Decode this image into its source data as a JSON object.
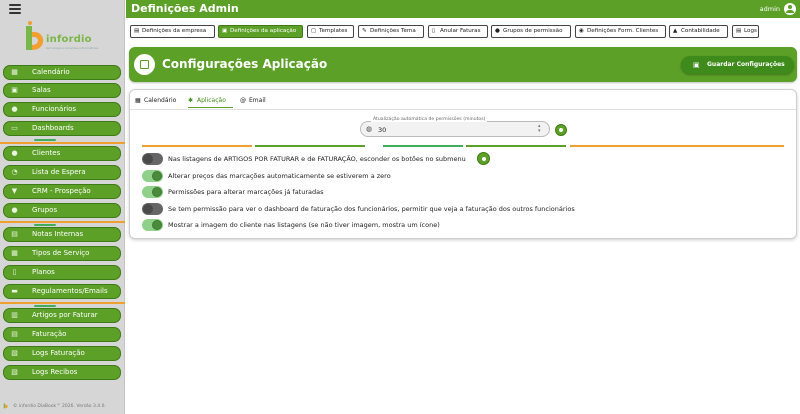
{
  "app": {
    "title": "Definições Admin",
    "user": "admin",
    "logo_text": "infordio",
    "logo_sub": "tecnologia e soluções informáticas",
    "footer": "© infordio DiaBook™ 2026. Versão 3.4.0."
  },
  "sidebar": {
    "items": [
      {
        "label": "Calendário",
        "icon": "calendar-icon"
      },
      {
        "label": "Salas",
        "icon": "door-icon"
      },
      {
        "label": "Funcionários",
        "icon": "users-icon"
      },
      {
        "label": "Dashboards",
        "icon": "monitor-icon"
      },
      {
        "label": "Clientes",
        "icon": "group-icon"
      },
      {
        "label": "Lista de Espera",
        "icon": "clock-icon"
      },
      {
        "label": "CRM - Prospeção",
        "icon": "funnel-icon"
      },
      {
        "label": "Grupos",
        "icon": "people-icon"
      },
      {
        "label": "Notas Internas",
        "icon": "note-icon"
      },
      {
        "label": "Tipos de Serviço",
        "icon": "list-icon"
      },
      {
        "label": "Planos",
        "icon": "document-icon"
      },
      {
        "label": "Regulamentos/Emails",
        "icon": "briefcase-icon"
      },
      {
        "label": "Artigos por Faturar",
        "icon": "basket-icon"
      },
      {
        "label": "Faturação",
        "icon": "invoice-icon"
      },
      {
        "label": "Logs Faturação",
        "icon": "log-icon"
      },
      {
        "label": "Logs Recibos",
        "icon": "receipt-icon"
      }
    ]
  },
  "tabs": [
    {
      "label": "Definições da empresa",
      "icon": "building-icon",
      "active": false
    },
    {
      "label": "Definições da aplicação",
      "icon": "app-icon",
      "active": true
    },
    {
      "label": "Templates",
      "icon": "template-icon",
      "active": false
    },
    {
      "label": "Definições Tema",
      "icon": "theme-icon",
      "active": false
    },
    {
      "label": "Anular Faturas",
      "icon": "cancel-invoice-icon",
      "active": false
    },
    {
      "label": "Grupos de permissão",
      "icon": "permission-icon",
      "active": false
    },
    {
      "label": "Definições Form. Clientes",
      "icon": "form-icon",
      "active": false
    },
    {
      "label": "Contabilidade",
      "icon": "accounting-icon",
      "active": false
    },
    {
      "label": "Logs",
      "icon": "logs-icon",
      "active": false
    }
  ],
  "header": {
    "title": "Configurações Aplicação",
    "save_label": "Guardar Configurações"
  },
  "subtabs": [
    {
      "label": "Calendário",
      "icon": "calendar-icon",
      "active": false
    },
    {
      "label": "Aplicação",
      "icon": "gear-icon",
      "active": true
    },
    {
      "label": "Email",
      "icon": "at-icon",
      "active": false
    }
  ],
  "permissions_field": {
    "label": "Atualização automática de permissões (minutos)",
    "value": "30"
  },
  "settings": [
    {
      "label": "Nas listagens de ARTIGOS POR FATURAR e de FATURAÇÃO, esconder os botões no submenu",
      "on": false
    },
    {
      "label": "Alterar preços das marcações automaticamente se estiverem a zero",
      "on": true
    },
    {
      "label": "Permissões para alterar marcações já faturadas",
      "on": true
    },
    {
      "label": "Se tem permissão para ver o dashboard de faturação dos funcionários, permitir que veja a faturação dos outros funcionários",
      "on": false
    },
    {
      "label": "Mostrar a imagem do cliente nas listagens (se não tiver imagem, mostra um ícone)",
      "on": true
    }
  ],
  "colors": {
    "brand_green": "#5da028",
    "dark_green": "#3e8a1a",
    "accent_orange": "#f0a030",
    "accent_teal": "#3fae5a"
  }
}
